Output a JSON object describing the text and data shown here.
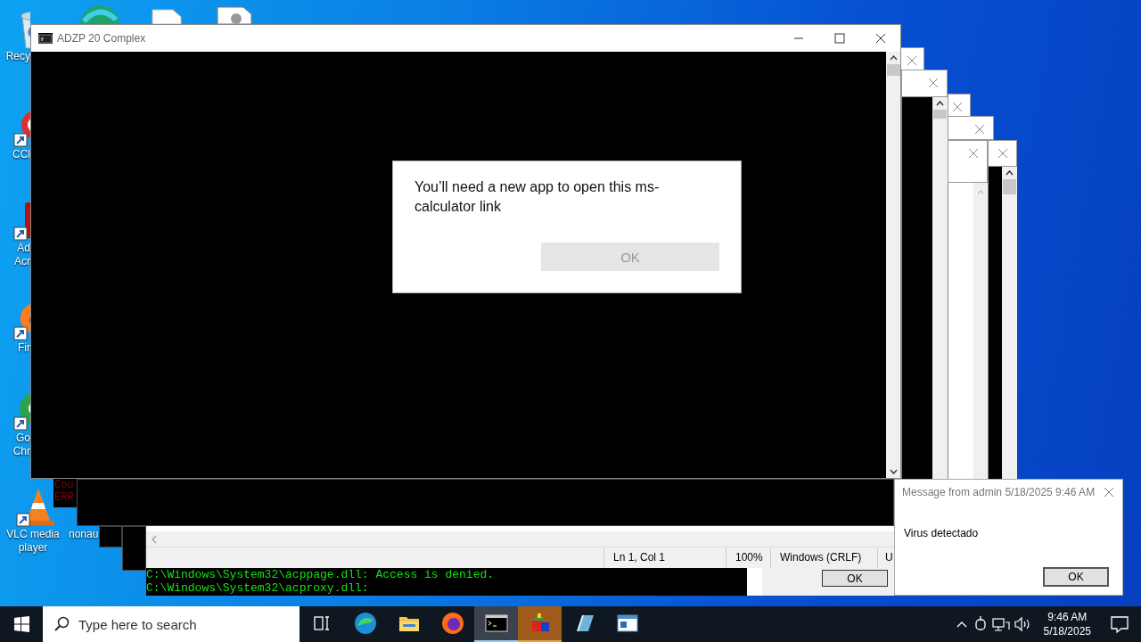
{
  "desktop_icons": [
    {
      "kind": "recycle-bin",
      "label_lines": [
        "Recy"
      ]
    },
    {
      "kind": "ccleaner",
      "label_lines": [
        "CCl"
      ]
    },
    {
      "kind": "acrobat",
      "label_lines": [
        "Ad",
        "Acr"
      ]
    },
    {
      "kind": "firefox",
      "label_lines": [
        "Fir"
      ]
    },
    {
      "kind": "chrome",
      "label_lines": [
        "Go",
        "Chr"
      ]
    },
    {
      "kind": "vlc",
      "label_lines": [
        "VLC media",
        "player"
      ]
    },
    {
      "kind": "hidden",
      "label_lines": [
        "nonau"
      ]
    }
  ],
  "main_window": {
    "title": "ADZP 20 Complex",
    "dialog": {
      "message": "You’ll need a new app to open this ms-calculator link",
      "button": {
        "label": "OK",
        "disabled": true
      }
    }
  },
  "console_behind": {
    "lines": [
      "Cou",
      "ERR"
    ]
  },
  "editor_status_bar": [
    "Ln 1, Col 1",
    "100%",
    "Windows (CRLF)",
    "U"
  ],
  "console": {
    "lines": [
      "C:\\Windows\\System32\\acppage.dll: Access is denied.",
      "C:\\Windows\\System32\\acproxy.dll:"
    ]
  },
  "small_dialog": {
    "button": "OK"
  },
  "message_box": {
    "title": "Message from admin 5/18/2025 9:46 AM",
    "message": "Virus detectado",
    "button": "OK"
  },
  "taskbar": {
    "search_placeholder": "Type here to search",
    "apps": [
      {
        "kind": "edge",
        "selected": false,
        "flashing": false
      },
      {
        "kind": "explorer",
        "selected": false,
        "flashing": false
      },
      {
        "kind": "firefox",
        "selected": false,
        "flashing": false
      },
      {
        "kind": "cmd",
        "selected": true,
        "flashing": false
      },
      {
        "kind": "cube",
        "selected": false,
        "flashing": true
      },
      {
        "kind": "book",
        "selected": false,
        "flashing": false
      },
      {
        "kind": "window",
        "selected": false,
        "flashing": false
      }
    ],
    "clock": {
      "time": "9:46 AM",
      "date": "5/18/2025"
    }
  }
}
